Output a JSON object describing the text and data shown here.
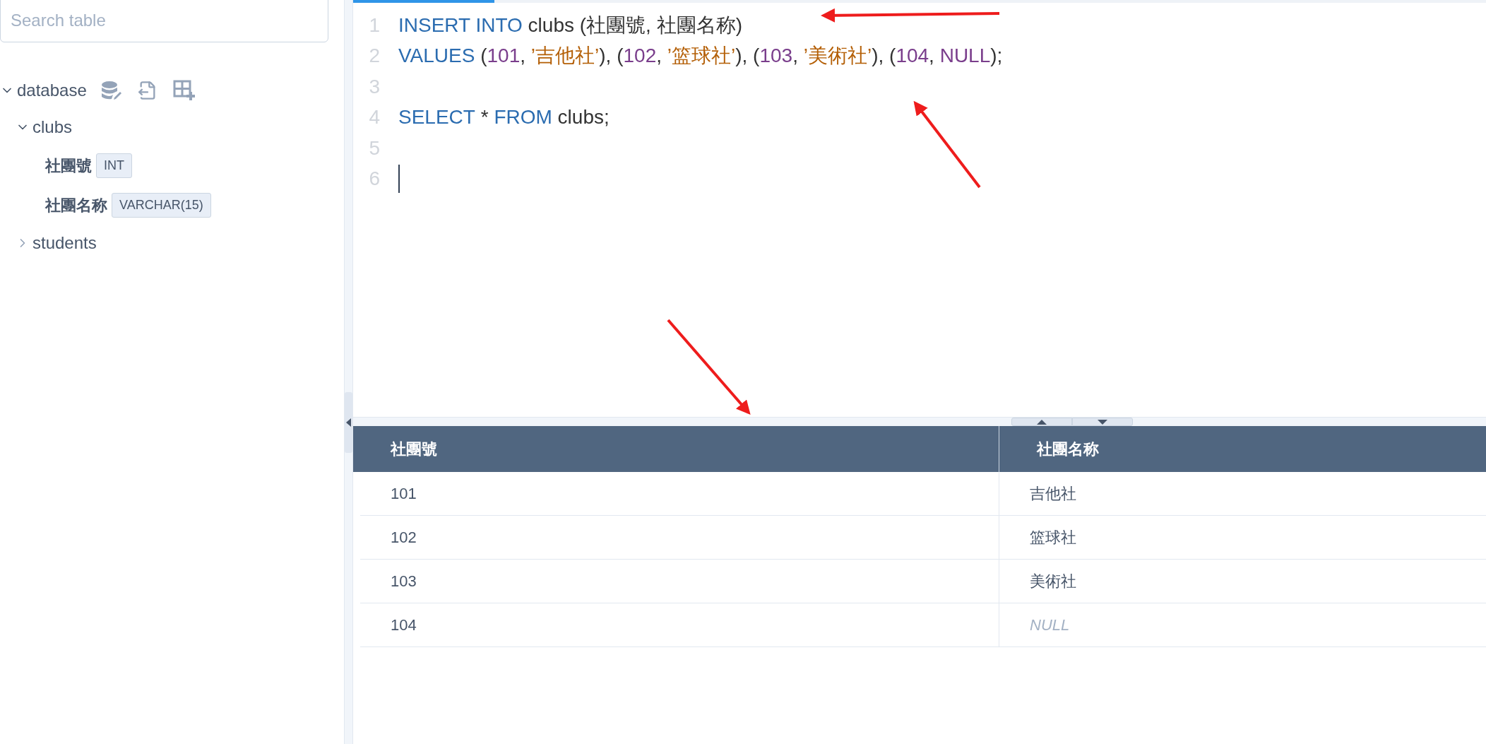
{
  "sidebar": {
    "search": {
      "placeholder": "Search table"
    },
    "tree": [
      {
        "label": "database",
        "expanded": true,
        "children": [
          {
            "label": "clubs",
            "expanded": true,
            "children": [
              {
                "label": "社團號",
                "type": "INT"
              },
              {
                "label": "社團名称",
                "type": "VARCHAR(15)"
              }
            ]
          },
          {
            "label": "students",
            "expanded": false
          }
        ]
      }
    ]
  },
  "editor": {
    "lines": [
      {
        "number": "1",
        "tokens": [
          {
            "kind": "keyword",
            "text": "INSERT INTO"
          },
          {
            "kind": "plain",
            "text": " clubs (社團號, 社團名称)"
          }
        ]
      },
      {
        "number": "2",
        "tokens": [
          {
            "kind": "keyword",
            "text": "VALUES"
          },
          {
            "kind": "plain",
            "text": " ("
          },
          {
            "kind": "number",
            "text": "101"
          },
          {
            "kind": "plain",
            "text": ", "
          },
          {
            "kind": "string",
            "text": "’吉他社’"
          },
          {
            "kind": "plain",
            "text": "), ("
          },
          {
            "kind": "number",
            "text": "102"
          },
          {
            "kind": "plain",
            "text": ", "
          },
          {
            "kind": "string",
            "text": "’篮球社’"
          },
          {
            "kind": "plain",
            "text": "), ("
          },
          {
            "kind": "number",
            "text": "103"
          },
          {
            "kind": "plain",
            "text": ", "
          },
          {
            "kind": "string",
            "text": "’美術社’"
          },
          {
            "kind": "plain",
            "text": "), ("
          },
          {
            "kind": "number",
            "text": "104"
          },
          {
            "kind": "plain",
            "text": ", "
          },
          {
            "kind": "number",
            "text": "NULL"
          },
          {
            "kind": "plain",
            "text": ");"
          }
        ]
      },
      {
        "number": "3"
      },
      {
        "number": "4",
        "tokens": [
          {
            "kind": "keyword",
            "text": "SELECT"
          },
          {
            "kind": "plain",
            "text": " * "
          },
          {
            "kind": "keyword",
            "text": "FROM"
          },
          {
            "kind": "plain",
            "text": " clubs;"
          }
        ]
      },
      {
        "number": "5"
      },
      {
        "number": "6",
        "cursor": true
      }
    ]
  },
  "result": {
    "columns": [
      "社團號",
      "社團名称"
    ],
    "rows": [
      [
        {
          "text": "101",
          "null": false
        },
        {
          "text": "吉他社",
          "null": false
        }
      ],
      [
        {
          "text": "102",
          "null": false
        },
        {
          "text": "篮球社",
          "null": false
        }
      ],
      [
        {
          "text": "103",
          "null": false
        },
        {
          "text": "美術社",
          "null": false
        }
      ],
      [
        {
          "text": "104",
          "null": false
        },
        {
          "text": "NULL",
          "null": true
        }
      ]
    ]
  }
}
